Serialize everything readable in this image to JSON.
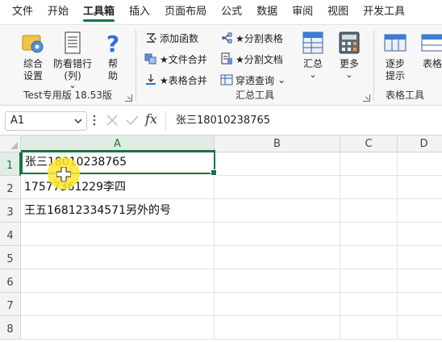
{
  "menu": {
    "items": [
      {
        "label": "文件"
      },
      {
        "label": "开始"
      },
      {
        "label": "工具箱",
        "active": true
      },
      {
        "label": "插入"
      },
      {
        "label": "页面布局"
      },
      {
        "label": "公式"
      },
      {
        "label": "数据"
      },
      {
        "label": "审阅"
      },
      {
        "label": "视图"
      },
      {
        "label": "开发工具"
      }
    ]
  },
  "ribbon": {
    "group1": {
      "label": "Test专用版 18.53版",
      "settings": "综合\n设置",
      "anti_typo": "防看错行\n(列)",
      "anti_typo_arrow": "⌄",
      "help": "帮\n助"
    },
    "group2": {
      "label": "汇总工具",
      "add_function": "添加函数",
      "merge_files": "★文件合并",
      "merge_tables": "★表格合并",
      "split_tables": "★分割表格",
      "split_docs": "★分割文档",
      "pivot_query": "穿透查询",
      "pivot_arrow": "⌄",
      "summary": "汇总",
      "summary_arrow": "⌄",
      "more": "更多",
      "more_arrow": "⌄"
    },
    "group3": {
      "label": "表格工具",
      "step_hint": "逐步\n提示",
      "table": "表格"
    }
  },
  "formula_bar": {
    "name_box": "A1",
    "fx": "fx",
    "content": "张三18010238765"
  },
  "sheet": {
    "columns": [
      "A",
      "B",
      "C",
      "D"
    ],
    "rows": [
      "1",
      "2",
      "3",
      "4",
      "5",
      "6",
      "7",
      "8"
    ],
    "cells": {
      "A1": "张三18010238765",
      "A2": "17577361229李四",
      "A3": "王五16812334571另外的号"
    }
  },
  "colors": {
    "accent": "#1a7340",
    "cursor_highlight": "#ffe628"
  }
}
